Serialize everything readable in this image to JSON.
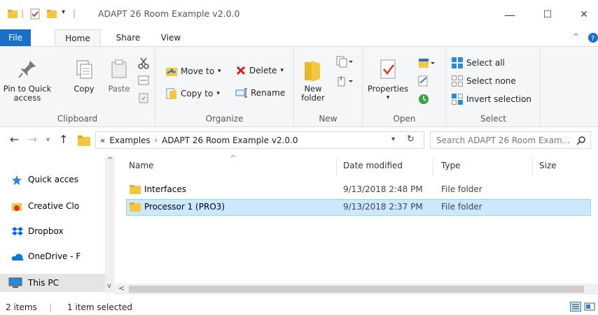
{
  "window": {
    "title": "ADAPT 26 Room Example v2.0.0",
    "minimize": "—",
    "maximize": "☐",
    "close": "✕"
  },
  "tabs": {
    "file": "File",
    "home": "Home",
    "share": "Share",
    "view": "View"
  },
  "ribbon": {
    "clipboard": {
      "label": "Clipboard",
      "pin_line1": "Pin to Quick",
      "pin_line2": "access",
      "copy": "Copy",
      "paste": "Paste"
    },
    "organize": {
      "label": "Organize",
      "move_to": "Move to",
      "copy_to": "Copy to",
      "delete": "Delete",
      "rename": "Rename"
    },
    "new": {
      "label": "New",
      "new_folder_line1": "New",
      "new_folder_line2": "folder"
    },
    "open": {
      "label": "Open",
      "properties": "Properties"
    },
    "select": {
      "label": "Select",
      "select_all": "Select all",
      "select_none": "Select none",
      "invert": "Invert selection"
    }
  },
  "address": {
    "overflow": "«",
    "crumbs": [
      "Examples",
      "ADAPT 26 Room Example v2.0.0"
    ],
    "separator": "›"
  },
  "search": {
    "placeholder": "Search ADAPT 26 Room Exam..."
  },
  "nav_pane": {
    "items": [
      {
        "label": "Quick acces",
        "icon": "star-icon"
      },
      {
        "label": "Creative Clo",
        "icon": "creative-cloud-icon"
      },
      {
        "label": "Dropbox",
        "icon": "dropbox-icon"
      },
      {
        "label": "OneDrive - F",
        "icon": "onedrive-icon"
      },
      {
        "label": "This PC",
        "icon": "computer-icon"
      }
    ]
  },
  "file_list": {
    "columns": {
      "name": "Name",
      "date": "Date modified",
      "type": "Type",
      "size": "Size"
    },
    "rows": [
      {
        "name": "Interfaces",
        "date": "9/13/2018 2:48 PM",
        "type": "File folder",
        "selected": false
      },
      {
        "name": "Processor 1 (PRO3)",
        "date": "9/13/2018 2:37 PM",
        "type": "File folder",
        "selected": true
      }
    ]
  },
  "status": {
    "items": "2 items",
    "selected": "1 item selected"
  },
  "colors": {
    "accent": "#1a6fc7",
    "selection": "#cce8ff",
    "folder": "#f3c73f"
  }
}
